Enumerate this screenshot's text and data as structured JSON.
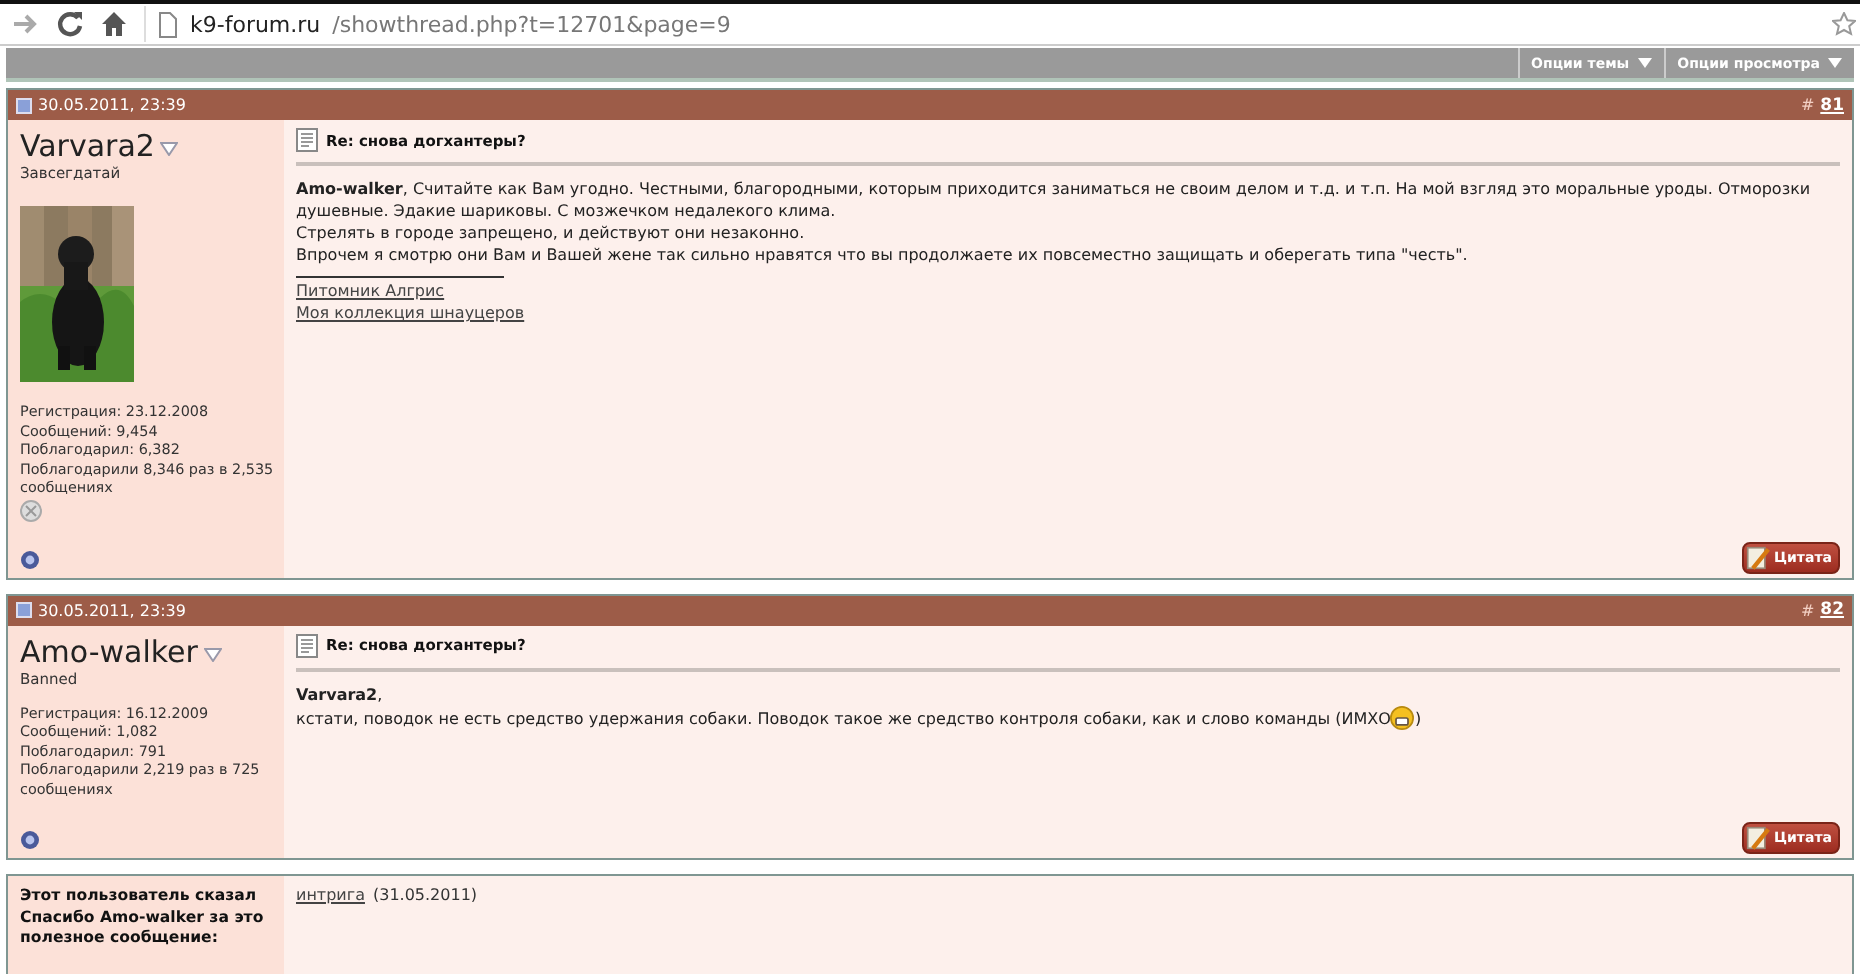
{
  "browser": {
    "url_host": "k9-forum.ru",
    "url_path": "/showthread.php?t=12701&page=9"
  },
  "toolbar": {
    "menus": [
      {
        "label": "Опции темы"
      },
      {
        "label": "Опции просмотра"
      }
    ]
  },
  "posts": [
    {
      "date": "30.05.2011, 23:39",
      "number_prefix": "#",
      "number": "81",
      "author": "Varvara2",
      "rank": "Завсегдатай",
      "avatar": {
        "kind": "picture"
      },
      "stats": [
        "Регистрация: 23.12.2008",
        "Сообщений: 9,454",
        "Поблагодарил: 6,382",
        "Поблагодарили 8,346 раз в 2,535 сообщениях"
      ],
      "reputation_icon": true,
      "title": "Re: снова догхантеры?",
      "paragraphs": [
        {
          "text": "**Amo-walker**, Считайте как Вам угодно. Честными, благородными, которым приходится заниматься не своим делом и т.д. и т.п. На мой взгляд это моральные уроды. Отморозки душевные. Эдакие шариковы. С мозжечком недалекого клима."
        },
        {
          "text": "Стрелять в городе запрещено, и действуют они незаконно."
        },
        {
          "text": "Впрочем я смотрю они Вам и Вашей жене так сильно нравятся что вы продолжаете их повсеместно защищать и оберегать типа \"честь\"."
        }
      ],
      "signature": [
        "Питомник Алгрис",
        "Моя коллекция шнауцеров"
      ],
      "quote_button": "Цитата"
    },
    {
      "date": "30.05.2011, 23:39",
      "number_prefix": "#",
      "number": "82",
      "author": "Amo-walker",
      "rank": "Banned",
      "stats": [
        "Регистрация: 16.12.2009",
        "Сообщений: 1,082",
        "Поблагодарил: 791",
        "Поблагодарили 2,219 раз в 725 сообщениях"
      ],
      "reputation_icon": false,
      "title": "Re: снова догхантеры?",
      "paragraphs": [
        {
          "text": "**Varvara2**,"
        },
        {
          "text": "кстати, поводок не есть средство удержания собаки. Поводок такое же средство контроля собаки, как и слово команды (ИМХО",
          "smiley": true,
          "after": ")"
        }
      ],
      "quote_button": "Цитата"
    }
  ],
  "thanks": {
    "label": "Этот пользователь сказал Спасибо Amo-walker за это полезное сообщение:",
    "users": [
      {
        "name": "интрига",
        "date": "(31.05.2011)"
      }
    ]
  }
}
